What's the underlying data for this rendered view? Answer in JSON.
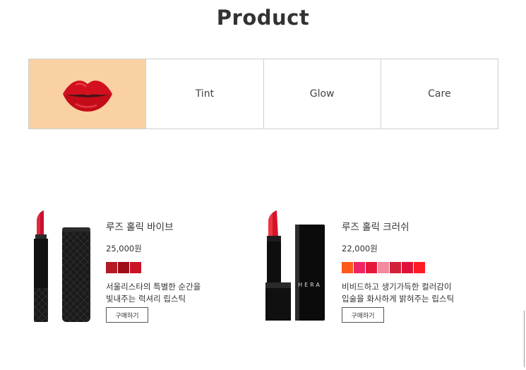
{
  "page": {
    "title": "Product"
  },
  "tabs": [
    {
      "label": "",
      "icon": "lips-icon",
      "active": true
    },
    {
      "label": "Tint",
      "active": false
    },
    {
      "label": "Glow",
      "active": false
    },
    {
      "label": "Care",
      "active": false
    }
  ],
  "colors": {
    "active_tab_bg": "#f9d1a3",
    "lip_red": "#d3101e"
  },
  "products": [
    {
      "name": "루즈 홀릭 바이브",
      "price": "25,000원",
      "swatches": [
        "#b41926",
        "#9e0d1a",
        "#cc1226"
      ],
      "description_line1": "서울리스타의 특별한 순간을",
      "description_line2": "빛내주는 럭셔리 립스틱",
      "buy_label": "구매하기"
    },
    {
      "name": "루즈 홀릭 크러쉬",
      "price": "22,000원",
      "swatches": [
        "#ff5a1a",
        "#f02465",
        "#e8183a",
        "#f28aa0",
        "#d3203a",
        "#e0103c",
        "#ff1b24"
      ],
      "description_line1": "비비드하고 생기가득한 컬러감이",
      "description_line2": "입술을 화사하게 밝혀주는 립스틱",
      "buy_label": "구매하기",
      "cap_brand": "HERA"
    }
  ]
}
